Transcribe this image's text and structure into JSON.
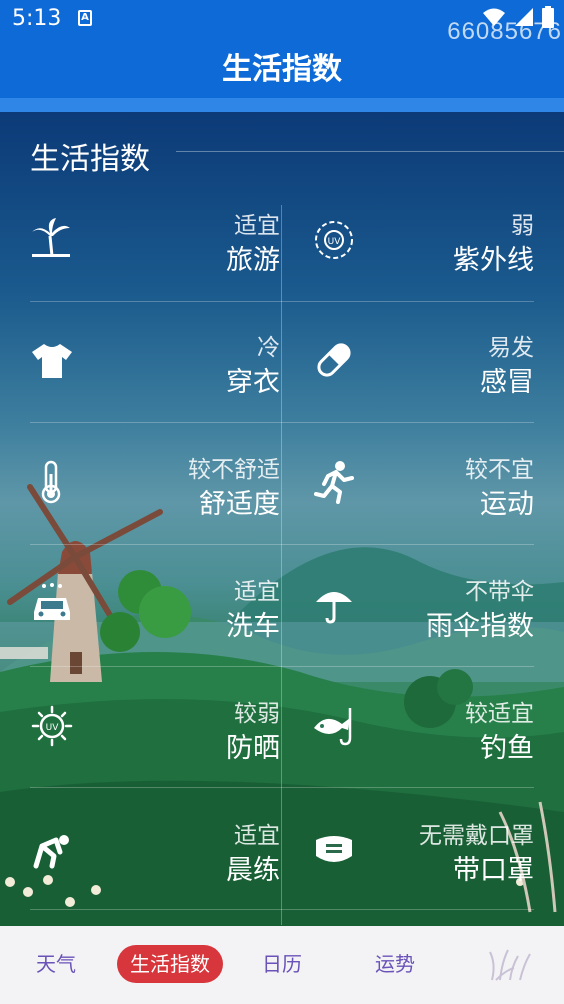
{
  "status_bar": {
    "time": "5:13",
    "notification_icon": "a-icon",
    "icons": [
      "wifi-icon",
      "signal-icon",
      "battery-icon"
    ]
  },
  "watermark": "66085676",
  "app_bar": {
    "title": "生活指数"
  },
  "section": {
    "title": "生活指数"
  },
  "indices": [
    {
      "name": "旅游",
      "status": "适宜",
      "icon": "palm-tree-icon"
    },
    {
      "name": "紫外线",
      "status": "弱",
      "icon": "uv-sun-icon"
    },
    {
      "name": "穿衣",
      "status": "冷",
      "icon": "tshirt-icon"
    },
    {
      "name": "感冒",
      "status": "易发",
      "icon": "pill-icon"
    },
    {
      "name": "舒适度",
      "status": "较不舒适",
      "icon": "thermometer-icon"
    },
    {
      "name": "运动",
      "status": "较不宜",
      "icon": "running-icon"
    },
    {
      "name": "洗车",
      "status": "适宜",
      "icon": "car-wash-icon"
    },
    {
      "name": "雨伞指数",
      "status": "不带伞",
      "icon": "umbrella-icon"
    },
    {
      "name": "防晒",
      "status": "较弱",
      "icon": "uv-sun-icon"
    },
    {
      "name": "钓鱼",
      "status": "较适宜",
      "icon": "fishing-icon"
    },
    {
      "name": "晨练",
      "status": "适宜",
      "icon": "exercise-icon"
    },
    {
      "name": "带口罩",
      "status": "无需戴口罩",
      "icon": "mask-icon"
    }
  ],
  "bottom_nav": {
    "tabs": [
      {
        "label": "天气",
        "active": false
      },
      {
        "label": "生活指数",
        "active": true
      },
      {
        "label": "日历",
        "active": false
      },
      {
        "label": "运势",
        "active": false
      }
    ],
    "more_icon": "grass-icon"
  },
  "colors": {
    "app_bar": "#0d6ad6",
    "active_tab": "#d7373c",
    "tab_text": "#6a52b8",
    "nav_bg": "#f3f3f5"
  }
}
